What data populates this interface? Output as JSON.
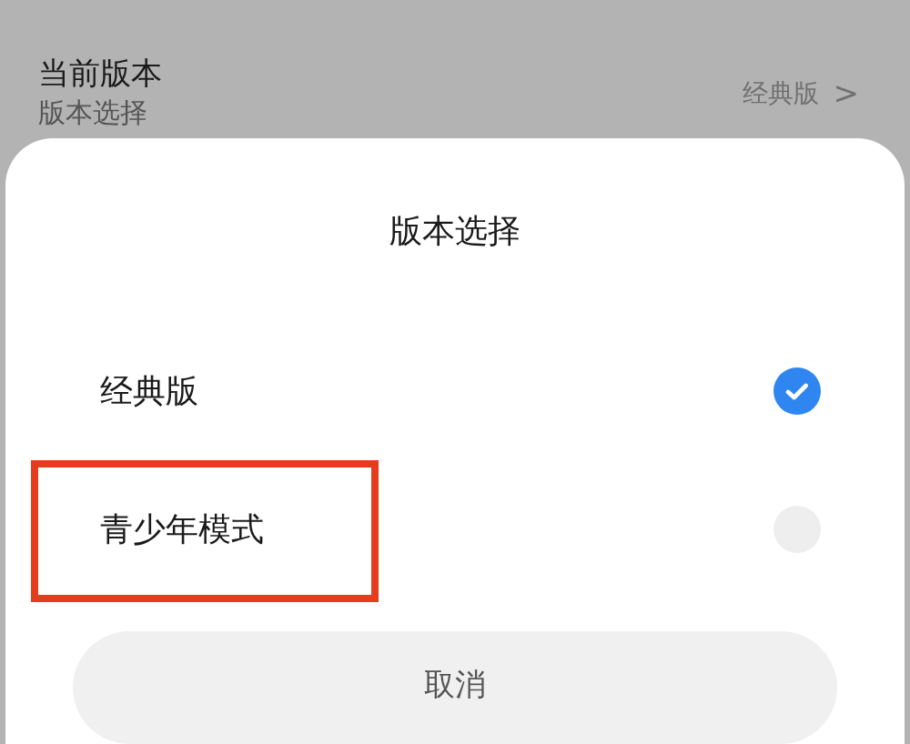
{
  "setting": {
    "title": "当前版本",
    "subtitle": "版本选择",
    "value": "经典版",
    "chevron": ">"
  },
  "dialog": {
    "title": "版本选择",
    "options": [
      {
        "label": "经典版",
        "selected": true,
        "highlighted": false
      },
      {
        "label": "青少年模式",
        "selected": false,
        "highlighted": true
      }
    ],
    "cancel": "取消"
  }
}
